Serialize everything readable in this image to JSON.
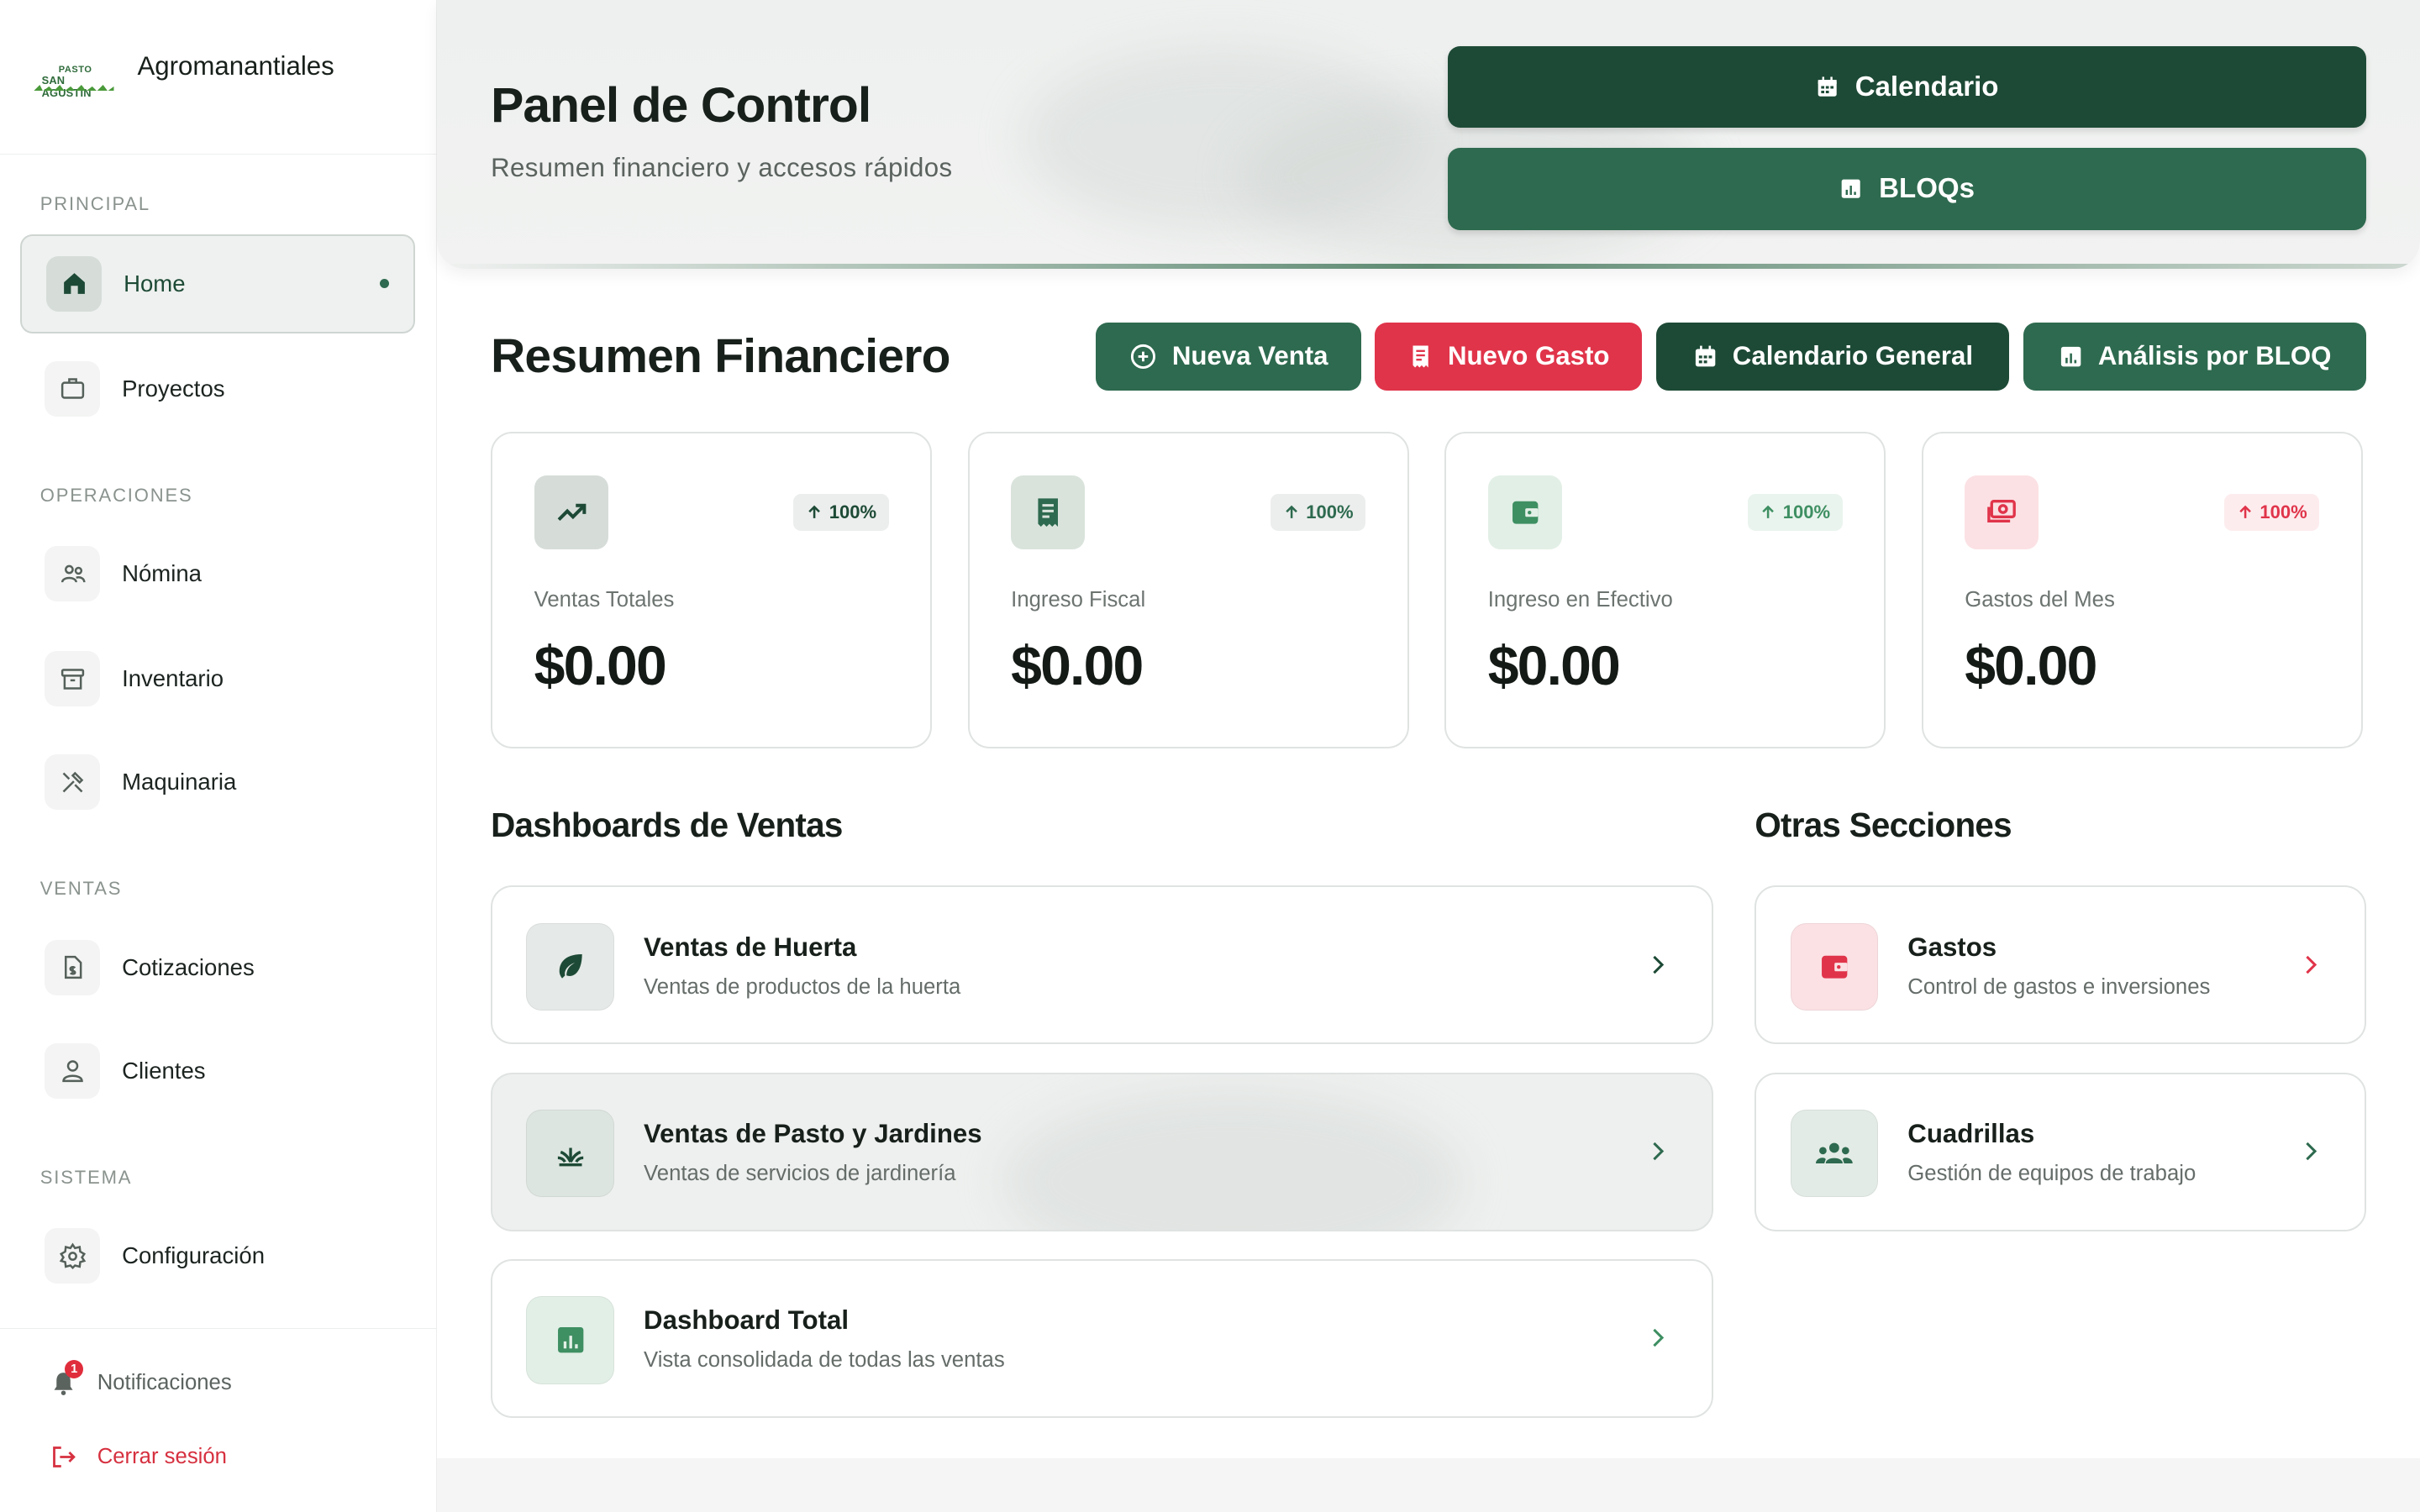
{
  "brand": {
    "logo_line1": "PASTO",
    "logo_line2": "SAN AGUSTÍN",
    "name": "Agromanantiales"
  },
  "sidebar": {
    "sections": [
      {
        "label": "PRINCIPAL"
      },
      {
        "label": "OPERACIONES"
      },
      {
        "label": "VENTAS"
      },
      {
        "label": "SISTEMA"
      }
    ],
    "items": [
      {
        "label": "Home",
        "icon": "home-icon",
        "active": true
      },
      {
        "label": "Proyectos",
        "icon": "briefcase-icon"
      },
      {
        "label": "Nómina",
        "icon": "people-icon"
      },
      {
        "label": "Inventario",
        "icon": "archive-icon"
      },
      {
        "label": "Maquinaria",
        "icon": "tools-icon"
      },
      {
        "label": "Cotizaciones",
        "icon": "invoice-icon"
      },
      {
        "label": "Clientes",
        "icon": "user-icon"
      },
      {
        "label": "Configuración",
        "icon": "gear-icon"
      }
    ],
    "footer": {
      "notifications_label": "Notificaciones",
      "notifications_count": "1",
      "logout_label": "Cerrar sesión"
    }
  },
  "header": {
    "title": "Panel de Control",
    "subtitle": "Resumen financiero y accesos rápidos",
    "calendar_button": "Calendario",
    "bloqs_button": "BLOQs"
  },
  "financial": {
    "title": "Resumen Financiero",
    "actions": [
      {
        "label": "Nueva Venta",
        "icon": "plus-circle-icon"
      },
      {
        "label": "Nuevo Gasto",
        "icon": "receipt-icon"
      },
      {
        "label": "Calendario General",
        "icon": "calendar-icon"
      },
      {
        "label": "Análisis por BLOQ",
        "icon": "chart-icon"
      }
    ],
    "stats": [
      {
        "label": "Ventas Totales",
        "value": "$0.00",
        "change": "100%",
        "icon": "trending-up-icon"
      },
      {
        "label": "Ingreso Fiscal",
        "value": "$0.00",
        "change": "100%",
        "icon": "receipt-icon"
      },
      {
        "label": "Ingreso en Efectivo",
        "value": "$0.00",
        "change": "100%",
        "icon": "wallet-icon"
      },
      {
        "label": "Gastos del Mes",
        "value": "$0.00",
        "change": "100%",
        "icon": "cash-icon"
      }
    ]
  },
  "sales_dashboards": {
    "title": "Dashboards de Ventas",
    "items": [
      {
        "title": "Ventas de Huerta",
        "desc": "Ventas de productos de la huerta",
        "icon": "leaf-icon"
      },
      {
        "title": "Ventas de Pasto y Jardines",
        "desc": "Ventas de servicios de jardinería",
        "icon": "grass-icon"
      },
      {
        "title": "Dashboard Total",
        "desc": "Vista consolidada de todas las ventas",
        "icon": "bar-chart-icon"
      }
    ]
  },
  "other_sections": {
    "title": "Otras Secciones",
    "items": [
      {
        "title": "Gastos",
        "desc": "Control de gastos e inversiones",
        "icon": "wallet-icon"
      },
      {
        "title": "Cuadrillas",
        "desc": "Gestión de equipos de trabajo",
        "icon": "group-icon"
      }
    ]
  },
  "colors": {
    "primary_dark": "#1d4a36",
    "primary": "#2e6a4f",
    "danger": "#e0344a",
    "accent_green": "#3e8f62"
  }
}
